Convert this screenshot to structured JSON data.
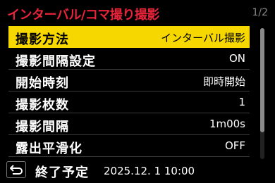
{
  "header": {
    "title": "インターバル/コマ撮り撮影",
    "page_indicator": "1/2"
  },
  "menu": {
    "items": [
      {
        "label": "撮影方法",
        "value": "インターバル撮影",
        "selected": true
      },
      {
        "label": "撮影間隔設定",
        "value": "ON"
      },
      {
        "label": "開始時刻",
        "value": "即時開始"
      },
      {
        "label": "撮影枚数",
        "value": "1"
      },
      {
        "label": "撮影間隔",
        "value": "1m00s"
      },
      {
        "label": "露出平滑化",
        "value": "OFF"
      }
    ]
  },
  "footer": {
    "back_icon": "return-arrow-icon",
    "end_label": "終了予定",
    "end_value": "2025.12. 1 10:00"
  },
  "colors": {
    "title": "#e8233a",
    "selection": "#f6d800",
    "background": "#000000"
  }
}
